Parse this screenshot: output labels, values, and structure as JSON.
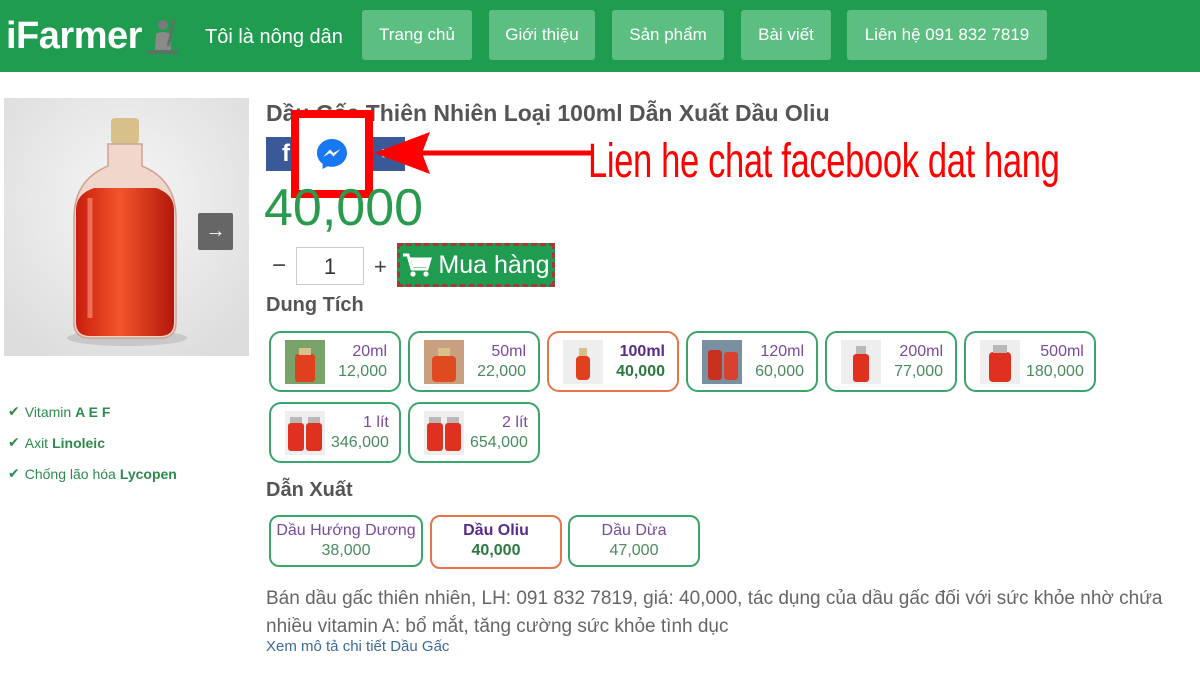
{
  "navbar": {
    "brand": "iFarmer",
    "brand_logo_icon": "farmer-hoe-icon",
    "tagline": "Tôi là nông dân",
    "items": [
      {
        "label": "Trang chủ"
      },
      {
        "label": "Giới thiệu"
      },
      {
        "label": "Sản phẩm"
      },
      {
        "label": "Bài viết"
      },
      {
        "label": "Liên hệ 091 832 7819"
      }
    ],
    "color": "#1f9c4f",
    "button_color": "#5cbf81"
  },
  "gallery": {
    "next_icon": "arrow-right-icon"
  },
  "features": [
    {
      "prefix": "Vitamin",
      "strong": "A E F"
    },
    {
      "prefix": "Axit",
      "strong": "Linoleic"
    },
    {
      "prefix": "Chống lão hóa",
      "strong": "Lycopen"
    }
  ],
  "product": {
    "title": "Dầu Gấc Thiên Nhiên Loại 100ml Dẫn Xuất Dầu Oliu",
    "price": "40,000",
    "quantity": "1",
    "qty_minus": "−",
    "qty_plus": "+",
    "buy_label": "Mua hàng"
  },
  "share": {
    "facebook": "f",
    "messenger_icon": "messenger-icon"
  },
  "annotation": {
    "text": "Lien he chat facebook dat hang",
    "color": "#ff0000"
  },
  "capacity": {
    "label": "Dung Tích",
    "options": [
      {
        "name": "20ml",
        "price": "12,000",
        "selected": false
      },
      {
        "name": "50ml",
        "price": "22,000",
        "selected": false
      },
      {
        "name": "100ml",
        "price": "40,000",
        "selected": true
      },
      {
        "name": "120ml",
        "price": "60,000",
        "selected": false
      },
      {
        "name": "200ml",
        "price": "77,000",
        "selected": false
      },
      {
        "name": "500ml",
        "price": "180,000",
        "selected": false
      },
      {
        "name": "1 lít",
        "price": "346,000",
        "selected": false
      },
      {
        "name": "2 lít",
        "price": "654,000",
        "selected": false
      }
    ]
  },
  "origin": {
    "label": "Dẫn Xuất",
    "options": [
      {
        "name": "Dầu Hướng Dương",
        "price": "38,000",
        "selected": false
      },
      {
        "name": "Dầu Oliu",
        "price": "40,000",
        "selected": true
      },
      {
        "name": "Dầu Dừa",
        "price": "47,000",
        "selected": false
      }
    ]
  },
  "description": {
    "text": "Bán dầu gấc thiên nhiên, LH: 091 832 7819, giá: 40,000, tác dụng của dầu gấc đối với sức khỏe nhờ chứa nhiều vitamin A: bổ mắt, tăng cường sức khỏe tình dục",
    "more_link": "Xem mô tả chi tiết Dầu Gấc"
  }
}
